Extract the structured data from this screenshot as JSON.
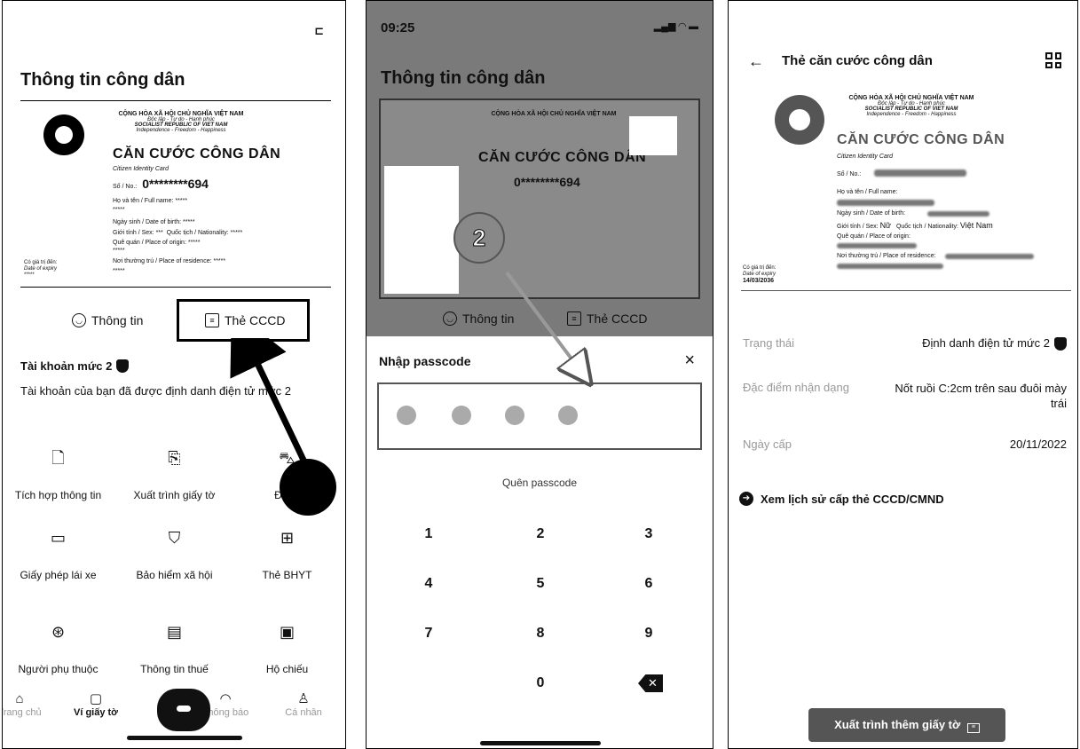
{
  "panel1": {
    "menu_glyph": "⊏",
    "title": "Thông tin công dân",
    "card": {
      "republic": "CỘNG HÒA XÃ HỘI CHỦ NGHĨA VIỆT NAM",
      "motto": "Độc lập - Tự do - Hạnh phúc",
      "republic_en": "SOCIALIST REPUBLIC OF VIET NAM",
      "motto_en": "Independence - Freedom - Happiness",
      "card_title": "CĂN CƯỚC CÔNG DÂN",
      "card_title_en": "Citizen Identity Card",
      "no_label": "Số / No.:",
      "no_value": "0********694",
      "name_label": "Họ và tên / Full name:",
      "dob_label": "Ngày sinh / Date of birth:",
      "sex_label": "Giới tính / Sex:",
      "nationality_label": "Quốc tịch / Nationality:",
      "origin_label": "Quê quán / Place of origin:",
      "residence_label": "Nơi thường trú / Place of residence:",
      "expiry_label": "Có giá trị đến:",
      "expiry_label_en": "Date of expiry",
      "masked": "*****",
      "masked_short": "***"
    },
    "tab_info": "Thông tin",
    "tab_card": "Thẻ CCCD",
    "account_heading": "Tài khoản mức 2",
    "account_text": "Tài khoản của bạn đã được định danh điện tử mức 2",
    "grid": [
      {
        "icon": "document-add-icon",
        "glyph": "🗋",
        "label": "Tích hợp thông tin"
      },
      {
        "icon": "present-docs-icon",
        "glyph": "⎘",
        "label": "Xuất trình giấy tờ"
      },
      {
        "icon": "car-icon",
        "glyph": "⛍",
        "label": "Đăng"
      },
      {
        "icon": "license-icon",
        "glyph": "▭",
        "label": "Giấy phép lái xe"
      },
      {
        "icon": "social-insurance-icon",
        "glyph": "⛉",
        "label": "Bảo hiểm xã hội"
      },
      {
        "icon": "health-insurance-icon",
        "glyph": "⊞",
        "label": "Thẻ BHYT"
      },
      {
        "icon": "dependent-icon",
        "glyph": "⊛",
        "label": "Người phụ thuộc"
      },
      {
        "icon": "tax-icon",
        "glyph": "▤",
        "label": "Thông tin thuế"
      },
      {
        "icon": "passport-icon",
        "glyph": "▣",
        "label": "Hộ chiếu"
      }
    ],
    "nav": [
      {
        "icon": "home-icon",
        "glyph": "⌂",
        "label": "Trang chủ",
        "active": false
      },
      {
        "icon": "wallet-icon",
        "glyph": "▢",
        "label": "Ví giấy tờ",
        "active": true
      },
      {
        "icon": "bell-icon",
        "glyph": "◠",
        "label": "Thông báo",
        "active": false
      },
      {
        "icon": "person-icon",
        "glyph": "♙",
        "label": "Cá nhân",
        "active": false
      }
    ]
  },
  "panel2": {
    "time": "09:25",
    "status_icons": "▂▄▆ ◠ ▬",
    "title": "Thông tin công dân",
    "step": "2",
    "card": {
      "republic": "CỘNG HÒA XÃ HỘI CHỦ NGHĨA VIỆT NAM",
      "card_title": "CĂN CƯỚC CÔNG DÂN",
      "no_value": "0********694"
    },
    "tab_info": "Thông tin",
    "tab_card": "Thẻ CCCD",
    "sheet_title": "Nhập passcode",
    "close": "×",
    "forgot": "Quên passcode",
    "keys": [
      "1",
      "2",
      "3",
      "4",
      "5",
      "6",
      "7",
      "8",
      "9",
      "0"
    ],
    "backspace": "✕"
  },
  "panel3": {
    "back": "←",
    "title": "Thẻ căn cước công dân",
    "card": {
      "republic": "CỘNG HÒA XÃ HỘI CHỦ NGHĨA VIỆT NAM",
      "motto": "Độc lập - Tự do - Hạnh phúc",
      "republic_en": "SOCIALIST REPUBLIC OF VIET NAM",
      "motto_en": "Independence - Freedom - Happiness",
      "card_title": "CĂN CƯỚC CÔNG DÂN",
      "card_title_en": "Citizen Identity Card",
      "no_label": "Số / No.:",
      "name_label": "Họ và tên / Full name:",
      "dob_label": "Ngày sinh / Date of birth:",
      "sex_label": "Giới tính / Sex:",
      "sex_value": "Nữ",
      "nationality_label": "Quốc tịch / Nationality:",
      "nationality_value": "Việt Nam",
      "origin_label": "Quê quán / Place of origin:",
      "residence_label": "Nơi thường trú / Place of residence:",
      "expiry_label": "Có giá trị đến:",
      "expiry_label_en": "Date of expiry",
      "expiry_value": "14/03/2036"
    },
    "rows": [
      {
        "label": "Trạng thái",
        "value": "Định danh điện tử mức 2"
      },
      {
        "label": "Đặc điểm nhận dạng",
        "value": "Nốt ruồi C:2cm trên sau đuôi mày trái"
      },
      {
        "label": "Ngày cấp",
        "value": "20/11/2022"
      }
    ],
    "history_link": "Xem lịch sử cấp thẻ CCCD/CMND",
    "export_button": "Xuất trình thêm giấy tờ"
  }
}
